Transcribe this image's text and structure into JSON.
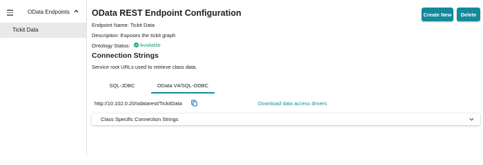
{
  "sidebar": {
    "title": "OData Endpoints",
    "items": [
      {
        "label": "Tickit Data"
      }
    ],
    "menu_icon": "hamburger-icon",
    "collapse_icon": "chevron-up-icon"
  },
  "header": {
    "title": "OData REST Endpoint Configuration",
    "create_label": "Create New",
    "delete_label": "Delete"
  },
  "details": {
    "endpoint_name": "Endpoint Name: Tickit Data",
    "description": "Description: Exposes the tickit graph",
    "status_label": "Ontology Status:",
    "status_value": "Available",
    "status_icon": "check-circle-icon"
  },
  "connection": {
    "title": "Connection Strings",
    "subtitle": "Service root URLs used to retrieve class data.",
    "tabs": [
      {
        "label": "SQL-JDBC"
      },
      {
        "label": "OData V4/SQL-ODBC"
      }
    ],
    "active_tab": 1,
    "url": "http://10.102.0.20/odatarest/TickitData",
    "copy_icon": "copy-icon",
    "download_link": "Download data access drivers",
    "accordion_label": "Class Specific Connection Strings",
    "accordion_icon": "chevron-down-icon"
  },
  "colors": {
    "accent": "#138a9c",
    "status_ok": "#16a37c",
    "sidebar_selected": "#e9e9e9"
  }
}
